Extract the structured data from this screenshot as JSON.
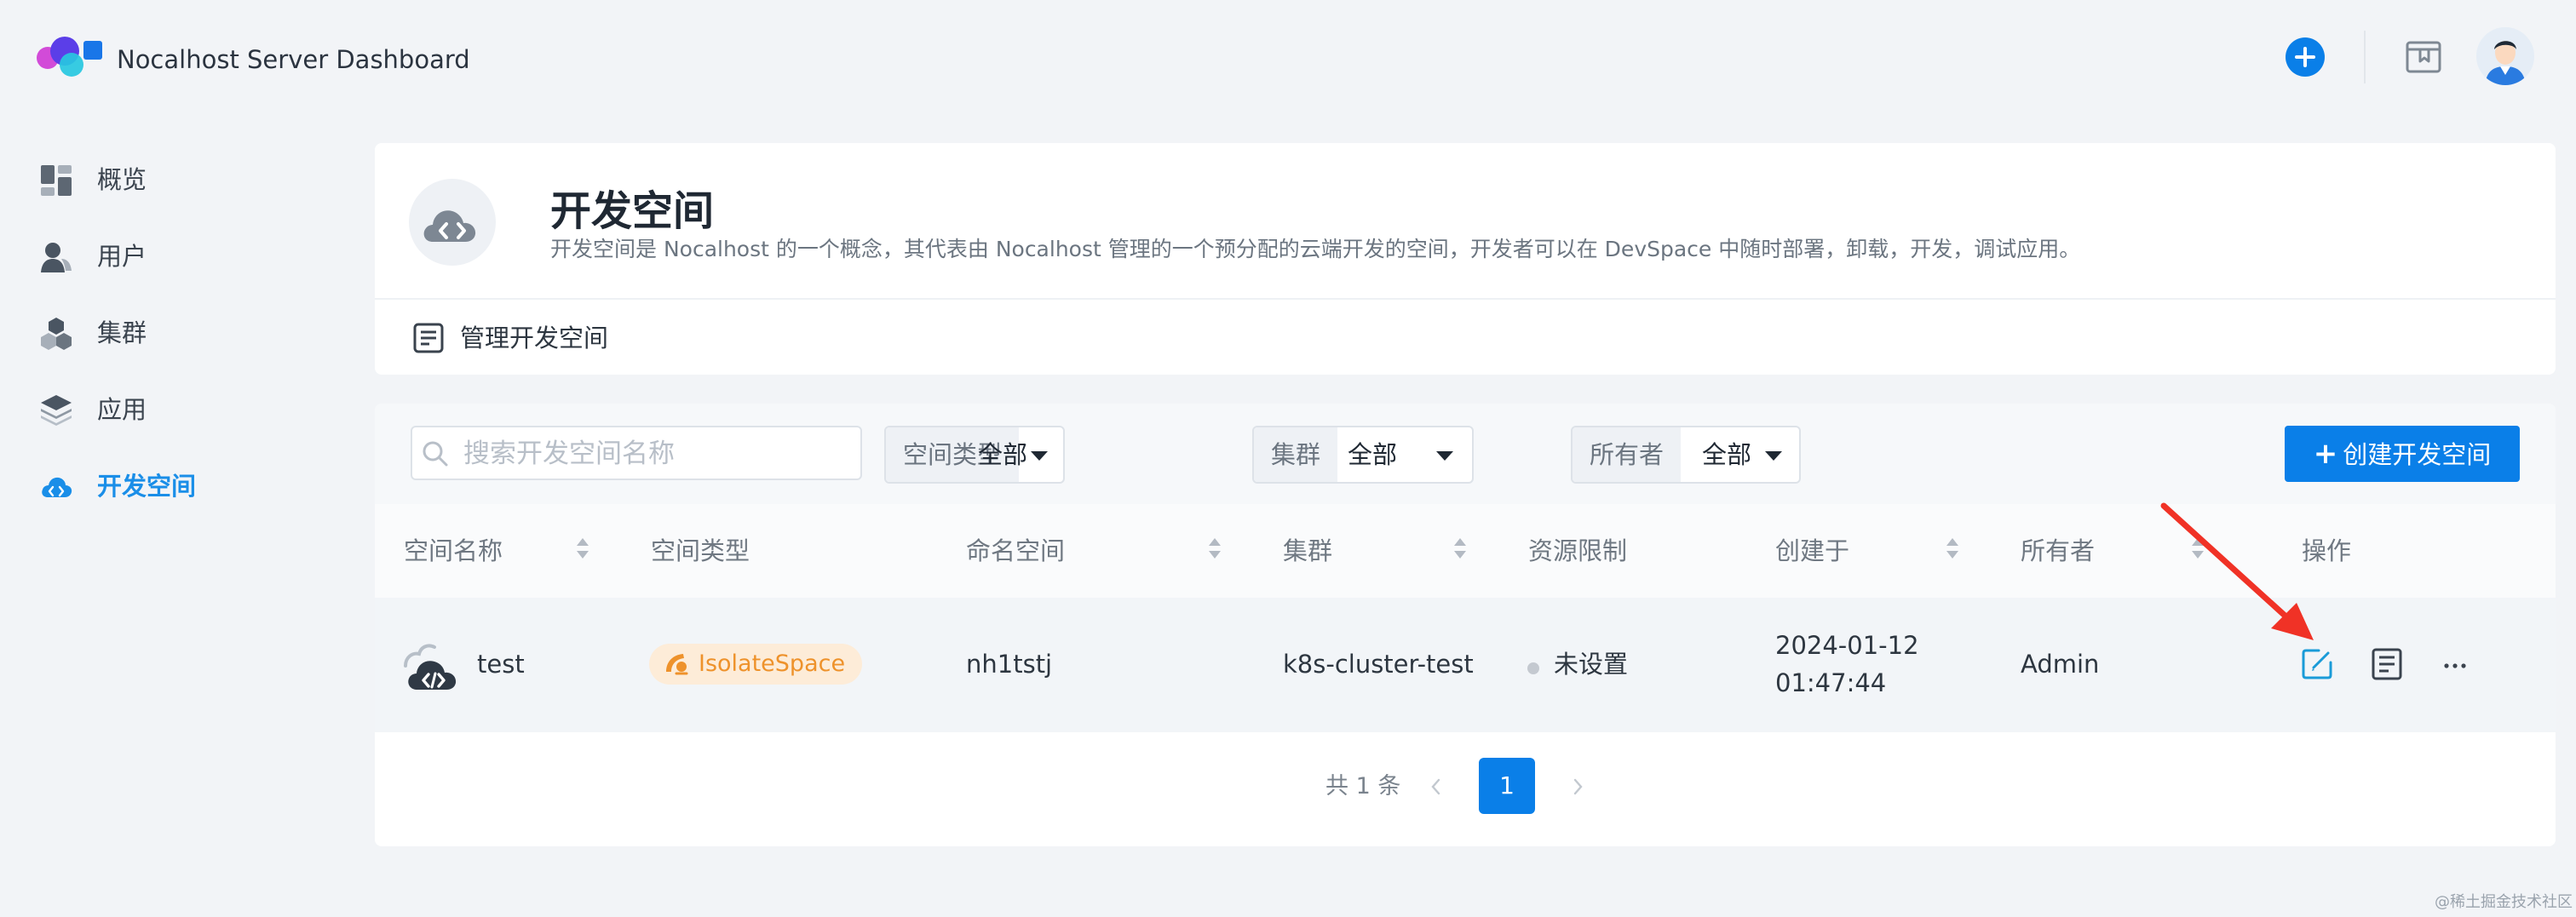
{
  "app": {
    "title": "Nocalhost Server Dashboard"
  },
  "header": {
    "add_icon": "plus-circle-icon",
    "book_icon": "bookmark-icon",
    "avatar_icon": "user-avatar-icon"
  },
  "sidebar": {
    "items": [
      {
        "label": "概览",
        "icon": "dashboard-icon"
      },
      {
        "label": "用户",
        "icon": "user-icon"
      },
      {
        "label": "集群",
        "icon": "cluster-icon"
      },
      {
        "label": "应用",
        "icon": "layers-icon"
      },
      {
        "label": "开发空间",
        "icon": "cloud-code-icon",
        "active": true
      }
    ]
  },
  "page": {
    "title": "开发空间",
    "description": "开发空间是 Nocalhost 的一个概念，其代表由 Nocalhost 管理的一个预分配的云端开发的空间，开发者可以在 DevSpace 中随时部署，卸载，开发，调试应用。",
    "manage_label": "管理开发空间"
  },
  "filters": {
    "search_placeholder": "搜索开发空间名称",
    "space_type": {
      "label": "空间类型",
      "value": "全部"
    },
    "cluster": {
      "label": "集群",
      "value": "全部"
    },
    "owner": {
      "label": "所有者",
      "value": "全部"
    },
    "create_button": "创建开发空间"
  },
  "table": {
    "columns": [
      "空间名称",
      "空间类型",
      "命名空间",
      "集群",
      "资源限制",
      "创建于",
      "所有者",
      "操作"
    ],
    "rows": [
      {
        "name": "test",
        "space_type": "IsolateSpace",
        "namespace": "nh1tstj",
        "cluster": "k8s-cluster-test",
        "resource_limit": "未设置",
        "created_date": "2024-01-12",
        "created_time": "01:47:44",
        "owner": "Admin",
        "actions": [
          "edit-icon",
          "detail-icon",
          "more-icon"
        ]
      }
    ]
  },
  "pagination": {
    "total_text": "共 1 条",
    "current_page": "1"
  },
  "watermark": "@稀土掘金技术社区",
  "colors": {
    "primary": "#0a7fe8",
    "active_nav": "#1a8ee8",
    "tag_bg": "#fdecd8",
    "tag_text": "#ee922b",
    "annotation_arrow": "#f03226"
  }
}
